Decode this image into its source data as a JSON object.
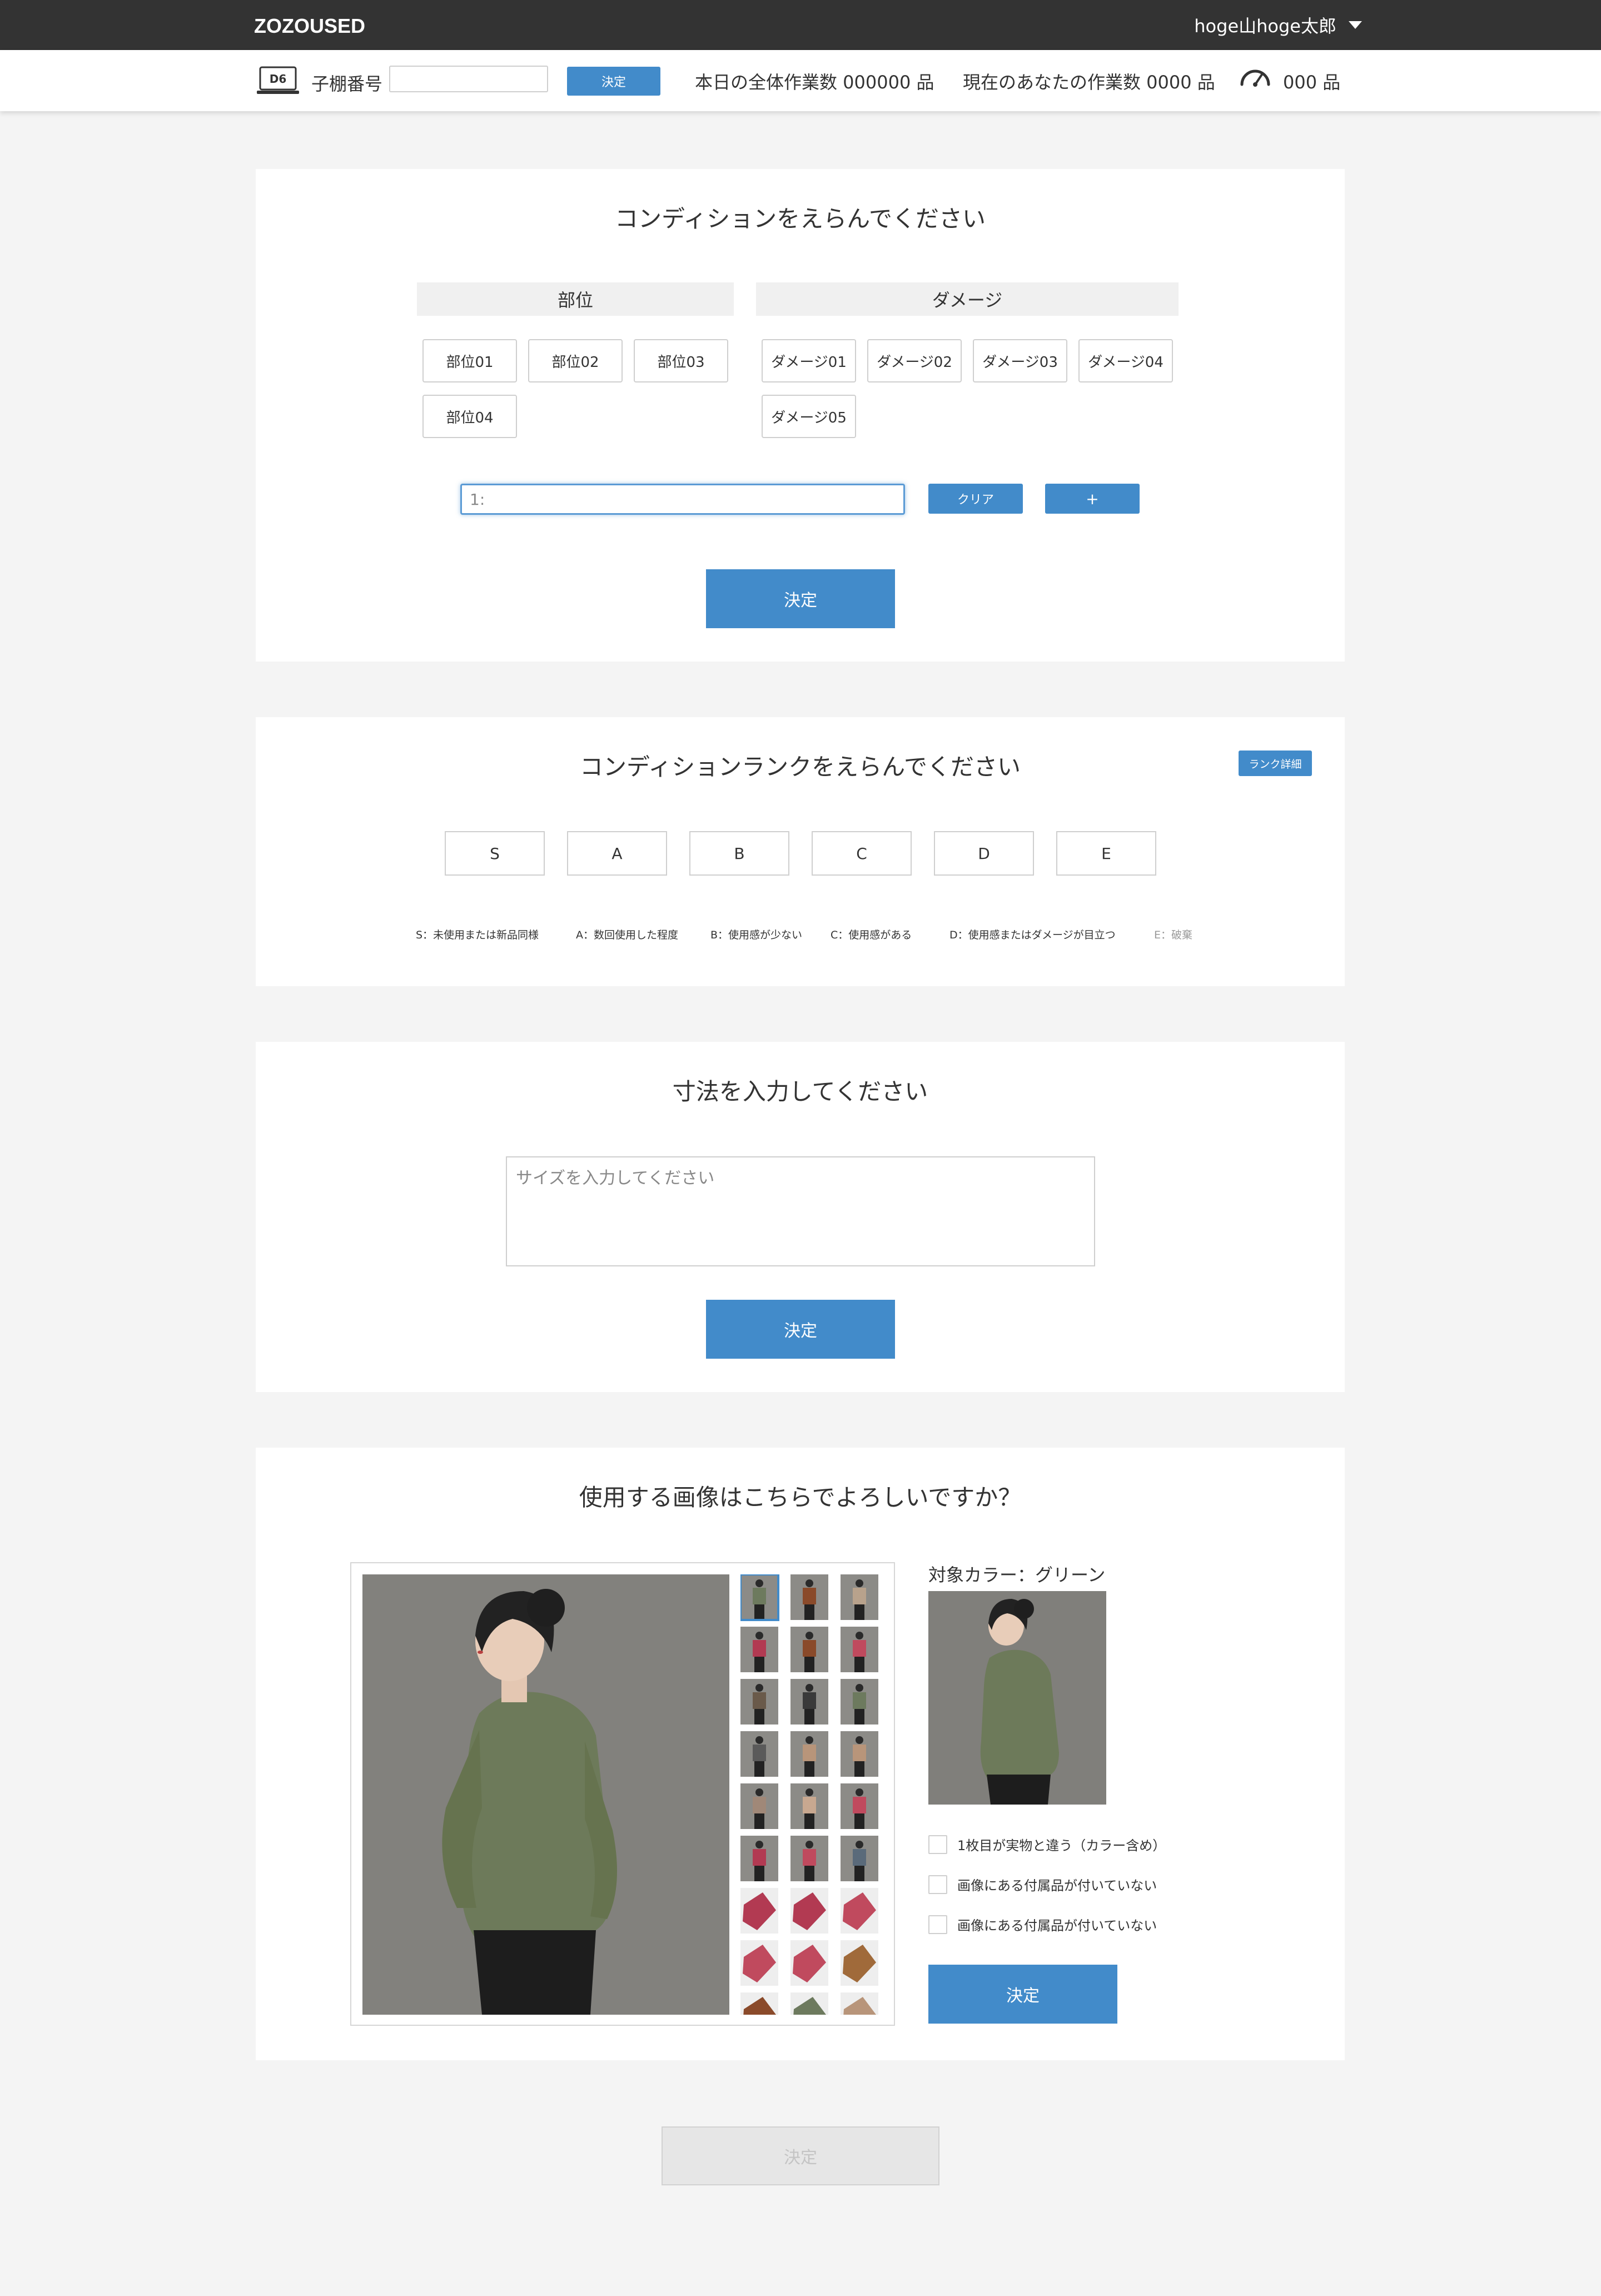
{
  "header": {
    "logo": "ZOZOUSED",
    "user_name": "hoge山hoge太郎"
  },
  "subbar": {
    "shelf_icon_text": "D6",
    "shelf_label": "子棚番号",
    "shelf_input_value": "",
    "shelf_button": "決定",
    "total_work": "本日の全体作業数  000000  品",
    "your_work": "現在のあなたの作業数  0000  品",
    "speed_work": "000  品"
  },
  "condition": {
    "title": "コンディションをえらんでください",
    "part_header": "部位",
    "damage_header": "ダメージ",
    "parts": [
      "部位01",
      "部位02",
      "部位03",
      "部位04"
    ],
    "damages": [
      "ダメージ01",
      "ダメージ02",
      "ダメージ03",
      "ダメージ04",
      "ダメージ05"
    ],
    "input_value": "1:",
    "clear_button": "クリア",
    "add_button": "+",
    "submit": "決定"
  },
  "rank": {
    "title": "コンディションランクをえらんでください",
    "detail_button": "ランク詳細",
    "ranks": [
      "S",
      "A",
      "B",
      "C",
      "D",
      "E"
    ],
    "legend": [
      "S：未使用または新品同様",
      "A：数回使用した程度",
      "B：使用感が少ない",
      "C：使用感がある",
      "D：使用感またはダメージが目立つ",
      "E：破棄"
    ]
  },
  "size": {
    "title": "寸法を入力してください",
    "placeholder": "サイズを入力してください",
    "submit": "決定"
  },
  "image": {
    "title": "使用する画像はこちらでよろしいですか？",
    "color_label": "対象カラー：グリーン",
    "checks": [
      "1枚目が実物と違う（カラー含め）",
      "画像にある付属品が付いていない",
      "画像にある付属品が付いていない"
    ],
    "submit": "決定",
    "thumb_colors": [
      "#6d7a5e",
      "#8a4a2a",
      "#b8a28c",
      "#b23a52",
      "#8a4a2a",
      "#c04a5e",
      "#6a5a4a",
      "#3a3a3a",
      "#6d7a5e",
      "#5a5a5a",
      "#b8957a",
      "#b8957a",
      "#a08878",
      "#c8a890",
      "#c04a5e",
      "#b23a52",
      "#c04a5e",
      "#5a6a7a",
      "#b23a52",
      "#b23a52",
      "#c04a5e",
      "#c04a5e",
      "#c04a5e",
      "#a06a3a",
      "#8a4a2a",
      "#6d7a5e",
      "#b8957a"
    ]
  },
  "final_submit": "決定",
  "colors": {
    "accent": "#428bca",
    "topbar": "#333333",
    "background": "#f4f4f4"
  }
}
